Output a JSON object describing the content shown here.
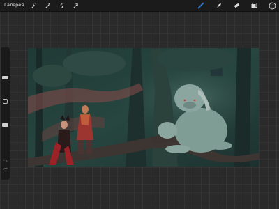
{
  "app": {
    "gallery_label": "Галерея"
  },
  "toolbar_left": {
    "icons": [
      "wrench-icon",
      "magic-wand-icon",
      "selection-icon",
      "transform-arrow-icon"
    ]
  },
  "toolbar_right": {
    "icons": [
      "brush-icon",
      "smudge-icon",
      "eraser-icon",
      "layers-icon",
      "color-icon"
    ],
    "active_tool": "brush",
    "active_color": "#2f7bd8",
    "current_color": "#2a2a2a"
  },
  "sidebar": {
    "brush_size": 0.28,
    "opacity": 0.78
  },
  "canvas": {
    "artwork": "forest-scene-illustration"
  }
}
